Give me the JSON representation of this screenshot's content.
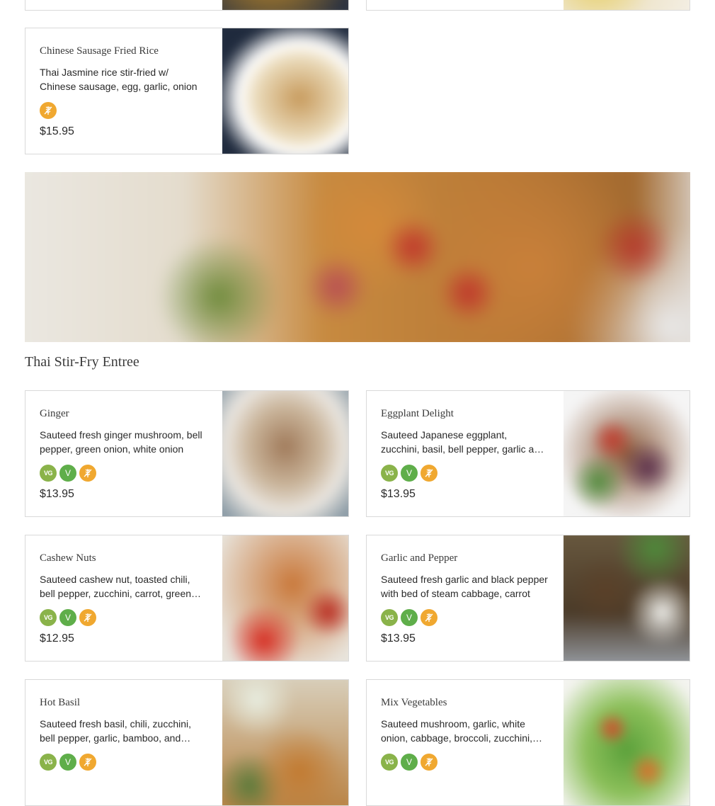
{
  "section": {
    "title": "Thai Stir-Fry Entree"
  },
  "badges": {
    "vg": "VG",
    "v": "V"
  },
  "colors": {
    "vegan": "#8ab34a",
    "vegetarian": "#5fae4a",
    "gluten_free": "#f0a830",
    "border": "#d9d9d9"
  },
  "icons": {
    "gluten_free": "wheat-icon"
  },
  "top_item": {
    "name": "Chinese Sausage Fried Rice",
    "desc": "Thai Jasmine rice stir-fried w/ Chinese sausage, egg, garlic, onion",
    "price": "$15.95"
  },
  "items": [
    {
      "name": "Ginger",
      "desc": "Sauteed fresh ginger mushroom, bell pepper, green onion, white onion",
      "price": "$13.95"
    },
    {
      "name": "Eggplant Delight",
      "desc": "Sauteed Japanese eggplant, zucchini, basil, bell pepper, garlic and chili",
      "price": "$13.95"
    },
    {
      "name": "Cashew Nuts",
      "desc": "Sauteed cashew nut, toasted chili, bell pepper, zucchini, carrot, green onion",
      "price": "$12.95"
    },
    {
      "name": "Garlic and Pepper",
      "desc": "Sauteed fresh garlic and black pepper with bed of steam cabbage, carrot",
      "price": "$13.95"
    },
    {
      "name": "Hot Basil",
      "desc": "Sauteed fresh basil, chili, zucchini, bell pepper, garlic, bamboo, and onion",
      "price": ""
    },
    {
      "name": "Mix Vegetables",
      "desc": "Sauteed mushroom, garlic, white onion, cabbage, broccoli, zucchini, carrot",
      "price": ""
    }
  ]
}
